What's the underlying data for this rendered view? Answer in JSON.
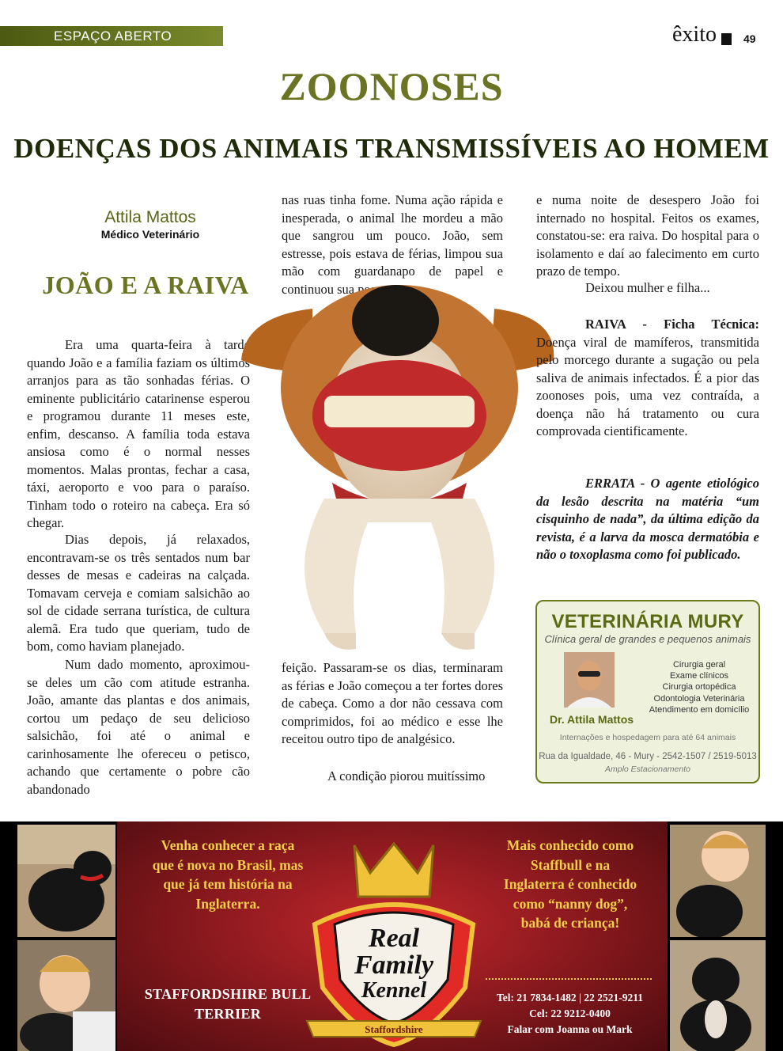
{
  "header": {
    "section": "ESPAÇO ABERTO",
    "magazine": "êxito",
    "page_number": "49"
  },
  "title": "ZOONOSES",
  "subtitle": "DOENÇAS DOS ANIMAIS TRANSMISSÍVEIS AO HOMEM",
  "author": {
    "name": "Attila Mattos",
    "role": "Médico Veterinário"
  },
  "article_heading": "JOÃO E A RAIVA",
  "article": {
    "p1": "Era uma quarta-feira à tarde quando João e a família faziam os últimos arranjos para as tão sonhadas férias. O eminente publicitário catarinense esperou e programou durante 11 meses este, enfim, descanso. A família toda estava ansiosa como é o normal nesses momentos. Malas prontas, fechar a casa, táxi, aeroporto e voo para o paraíso. Tinham todo o roteiro na cabeça. Era só chegar.",
    "p2": "Dias depois, já relaxados, encontravam-se os três sentados num bar desses de mesas e cadeiras na calçada. Tomavam cerveja e comiam salsichão ao sol de cidade serrana turística, de cultura alemã. Era tudo que queriam, tudo de bom, como haviam planejado.",
    "p3": "Num dado momento, aproximou-se deles um cão com atitude estranha. João, amante das plantas e dos animais, cortou um pedaço de seu delicioso salsichão, foi até o animal e carinhosamente lhe ofereceu o petisco, achando que certamente o pobre cão abandonado",
    "p4": "nas ruas tinha fome. Numa ação rápida e inesperada, o animal lhe mordeu a mão que sangrou um pouco. João, sem estresse, pois estava de férias, limpou sua mão com guardanapo de papel e continuou sua pequena refeição. Passaram-se os dias, terminaram as férias e João começou a ter fortes dores de cabeça. Como a dor não cessava com comprimidos, foi ao médico e esse lhe receitou outro tipo de analgésico.",
    "p4_top": "nas ruas tinha fome. Numa ação rápida e inesperada, o animal lhe mordeu a mão que sangrou um pouco. João, sem estresse, pois estava de férias, limpou sua mão com guardanapo de papel e continuou sua pequena re-",
    "p4_bottom": "feição. Passaram-se os dias, terminaram as férias e João começou a ter fortes dores de cabeça. Como a dor não cessava com comprimidos, foi ao médico e esse lhe receitou outro tipo de analgésico.",
    "p5": "A condição piorou muitíssimo",
    "p6": "e numa noite de desespero João foi internado no hospital. Feitos os exames, constatou-se: era raiva. Do hospital para o isolamento e daí ao falecimento em curto prazo de tempo.",
    "p7": "Deixou mulher e filha...",
    "ficha_label": "RAIVA - Ficha Técnica:",
    "ficha_text": "Doença viral de mamíferos, transmitida pelo morcego durante a sugação ou pela saliva de animais infectados. É a pior das zoonoses pois, uma vez contraída, a doença não há tratamento ou cura comprovada cientificamente.",
    "errata_label": "ERRATA -",
    "errata_text": "O agente etiológico da lesão descrita na matéria “um cisquinho de nada”, da última edição da revista, é a larva da mosca dermatóbia e não o toxoplasma como foi publicado."
  },
  "vet_ad": {
    "title": "VETERINÁRIA MURY",
    "subtitle": "Clínica geral de grandes e pequenos animais",
    "services": [
      "Cirurgia geral",
      "Exame clínicos",
      "Cirurgia ortopédica",
      "Odontologia Veterinária",
      "Atendimento em domicílio"
    ],
    "doctor": "Dr. Attila Mattos",
    "note": "Internações e hospedagem para até 64 animais",
    "address": "Rua da Igualdade, 46 - Mury  -  2542-1507 / 2519-5013",
    "parking": "Amplo Estacionamento"
  },
  "kennel_ad": {
    "left_text": "Venha conhecer a raça que é nova no Brasil, mas que já tem história na Inglaterra.",
    "breed": "STAFFORDSHIRE BULL TERRIER",
    "right_text": "Mais conhecido como Staffbull e na Inglaterra é conhecido como “nanny dog”, babá de criança!",
    "logo_line1": "Real",
    "logo_line2": "Family",
    "logo_line3": "Kennel",
    "logo_banner": "Staffordshire",
    "tel": "Tel: 21 7834-1482 | 22 2521-9211",
    "cel": "Cel: 22 9212-0400",
    "contact": "Falar com Joanna ou Mark"
  },
  "colors": {
    "olive": "#6b7422",
    "dark_olive": "#1f2a08",
    "ad_red": "#8e1a1f",
    "ad_gold": "#f2cf49"
  }
}
